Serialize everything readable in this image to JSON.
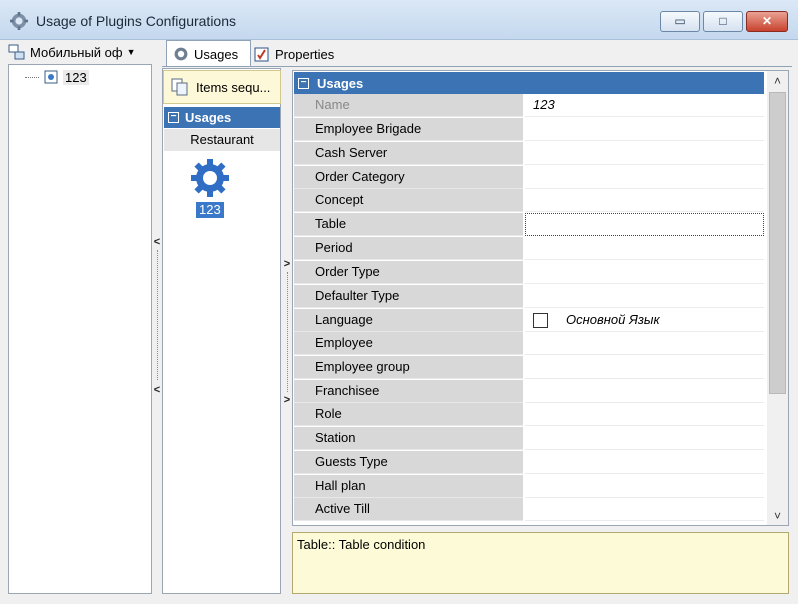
{
  "window": {
    "title": "Usage of Plugins Configurations",
    "buttons": {
      "minimize": "▭",
      "maximize": "□",
      "close": "✕"
    }
  },
  "tree": {
    "dropdown_label": "Мобильный оф",
    "node_label": "123"
  },
  "tabs": [
    {
      "label": "Usages",
      "active": true
    },
    {
      "label": "Properties",
      "active": false
    }
  ],
  "middle": {
    "items_sequence_label": "Items sequ...",
    "group_header": "Usages",
    "category": "Restaurant",
    "item_label": "123"
  },
  "grid": {
    "header": "Usages",
    "rows": [
      {
        "name": "Name",
        "value": "123"
      },
      {
        "name": "Employee Brigade",
        "value": ""
      },
      {
        "name": "Cash Server",
        "value": ""
      },
      {
        "name": "Order Category",
        "value": ""
      },
      {
        "name": "Concept",
        "value": ""
      },
      {
        "name": "Table",
        "value": ""
      },
      {
        "name": "Period",
        "value": ""
      },
      {
        "name": "Order Type",
        "value": ""
      },
      {
        "name": "Defaulter Type",
        "value": ""
      },
      {
        "name": "Language",
        "value": "Основной Язык",
        "checked": false
      },
      {
        "name": "Employee",
        "value": ""
      },
      {
        "name": "Employee group",
        "value": ""
      },
      {
        "name": "Franchisee",
        "value": ""
      },
      {
        "name": "Role",
        "value": ""
      },
      {
        "name": "Station",
        "value": ""
      },
      {
        "name": "Guests Type",
        "value": ""
      },
      {
        "name": "Hall plan",
        "value": ""
      },
      {
        "name": "Active Till",
        "value": ""
      }
    ]
  },
  "description": "Table:: Table condition",
  "colors": {
    "header_blue": "#3b73b4",
    "selection_blue": "#3a79c9",
    "desc_background": "#fdfbd7"
  }
}
